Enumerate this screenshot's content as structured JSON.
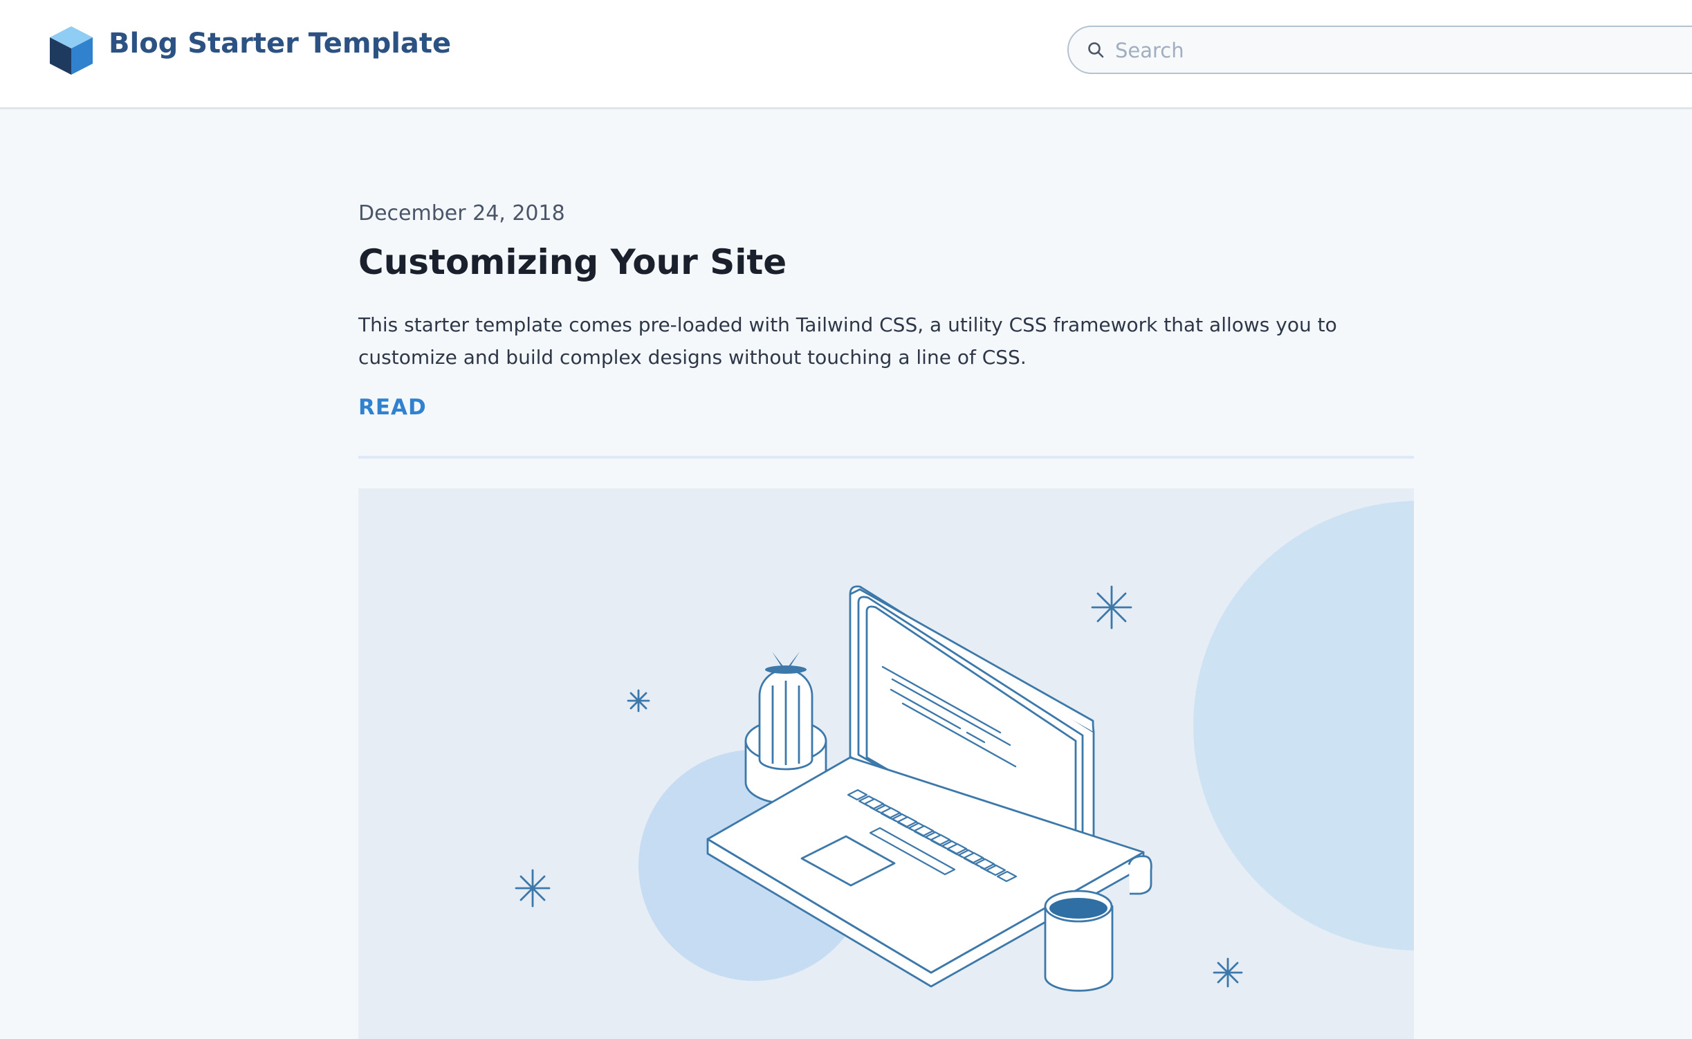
{
  "header": {
    "site_title": "Blog Starter Template",
    "logo_icon": "cube-logo-icon",
    "search": {
      "placeholder": "Search",
      "value": "",
      "icon": "search-icon"
    }
  },
  "post": {
    "date": "December 24, 2018",
    "title": "Customizing Your Site",
    "excerpt": "This starter template comes pre-loaded with Tailwind CSS, a utility CSS framework that allows you to customize and build complex designs without touching a line of CSS.",
    "read_label": "READ"
  },
  "hero_image": {
    "description_icon": "laptop-illustration-icon"
  },
  "colors": {
    "brand": "#2b5282",
    "link": "#3182ce",
    "background": "#f5f8fb",
    "illustration_stroke": "#3c78aa",
    "illustration_bg": "#e6edf5",
    "circle_fill": "#cde3f4"
  }
}
